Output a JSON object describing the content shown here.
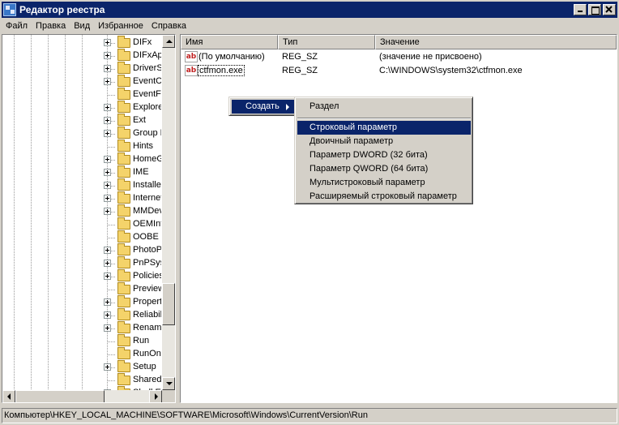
{
  "window": {
    "title": "Редактор реестра"
  },
  "menubar": [
    "Файл",
    "Правка",
    "Вид",
    "Избранное",
    "Справка"
  ],
  "tree": {
    "items": [
      {
        "label": "DIFx",
        "expandable": true
      },
      {
        "label": "DIFxApp",
        "expandable": true
      },
      {
        "label": "DriverSearching",
        "expandable": true
      },
      {
        "label": "EventCollector",
        "expandable": true
      },
      {
        "label": "EventForwarding",
        "expandable": false
      },
      {
        "label": "Explorer",
        "expandable": true
      },
      {
        "label": "Ext",
        "expandable": true
      },
      {
        "label": "Group Policy",
        "expandable": true
      },
      {
        "label": "Hints",
        "expandable": false
      },
      {
        "label": "HomeGroup",
        "expandable": true
      },
      {
        "label": "IME",
        "expandable": true
      },
      {
        "label": "Installer",
        "expandable": true
      },
      {
        "label": "Internet Settings",
        "expandable": true
      },
      {
        "label": "MMDevices",
        "expandable": true
      },
      {
        "label": "OEMInformation",
        "expandable": false
      },
      {
        "label": "OOBE",
        "expandable": false
      },
      {
        "label": "PhotoPropertyHandler",
        "expandable": true
      },
      {
        "label": "PnPSysprep",
        "expandable": true
      },
      {
        "label": "Policies",
        "expandable": true
      },
      {
        "label": "PreviewHandlers",
        "expandable": false
      },
      {
        "label": "PropertySystem",
        "expandable": true
      },
      {
        "label": "Reliability",
        "expandable": true
      },
      {
        "label": "RenameFiles",
        "expandable": true
      },
      {
        "label": "Run",
        "expandable": false
      },
      {
        "label": "RunOnce",
        "expandable": false
      },
      {
        "label": "Setup",
        "expandable": true
      },
      {
        "label": "SharedDLLs",
        "expandable": false
      },
      {
        "label": "Shell Extensions",
        "expandable": true
      }
    ],
    "scroll_position": 0.82
  },
  "list": {
    "columns": [
      "Имя",
      "Тип",
      "Значение"
    ],
    "rows": [
      {
        "name": "(По умолчанию)",
        "type": "REG_SZ",
        "value": "(значение не присвоено)",
        "icon": "string-value-icon"
      },
      {
        "name": "ctfmon.exe",
        "type": "REG_SZ",
        "value": "C:\\WINDOWS\\system32\\ctfmon.exe",
        "icon": "string-value-icon",
        "editing": true
      }
    ]
  },
  "context_menu": {
    "create_label": "Создать",
    "submenu": [
      {
        "label": "Раздел"
      },
      {
        "separator": true
      },
      {
        "label": "Строковый параметр",
        "highlighted": true
      },
      {
        "label": "Двоичный параметр"
      },
      {
        "label": "Параметр DWORD (32 бита)"
      },
      {
        "label": "Параметр QWORD (64 бита)"
      },
      {
        "label": "Мультистроковый параметр"
      },
      {
        "label": "Расширяемый строковый параметр"
      }
    ]
  },
  "statusbar": {
    "path": "Компьютер\\HKEY_LOCAL_MACHINE\\SOFTWARE\\Microsoft\\Windows\\CurrentVersion\\Run"
  },
  "colors": {
    "titlebar": "#0a246a",
    "highlight": "#0a246a",
    "face": "#d4d0c8"
  }
}
